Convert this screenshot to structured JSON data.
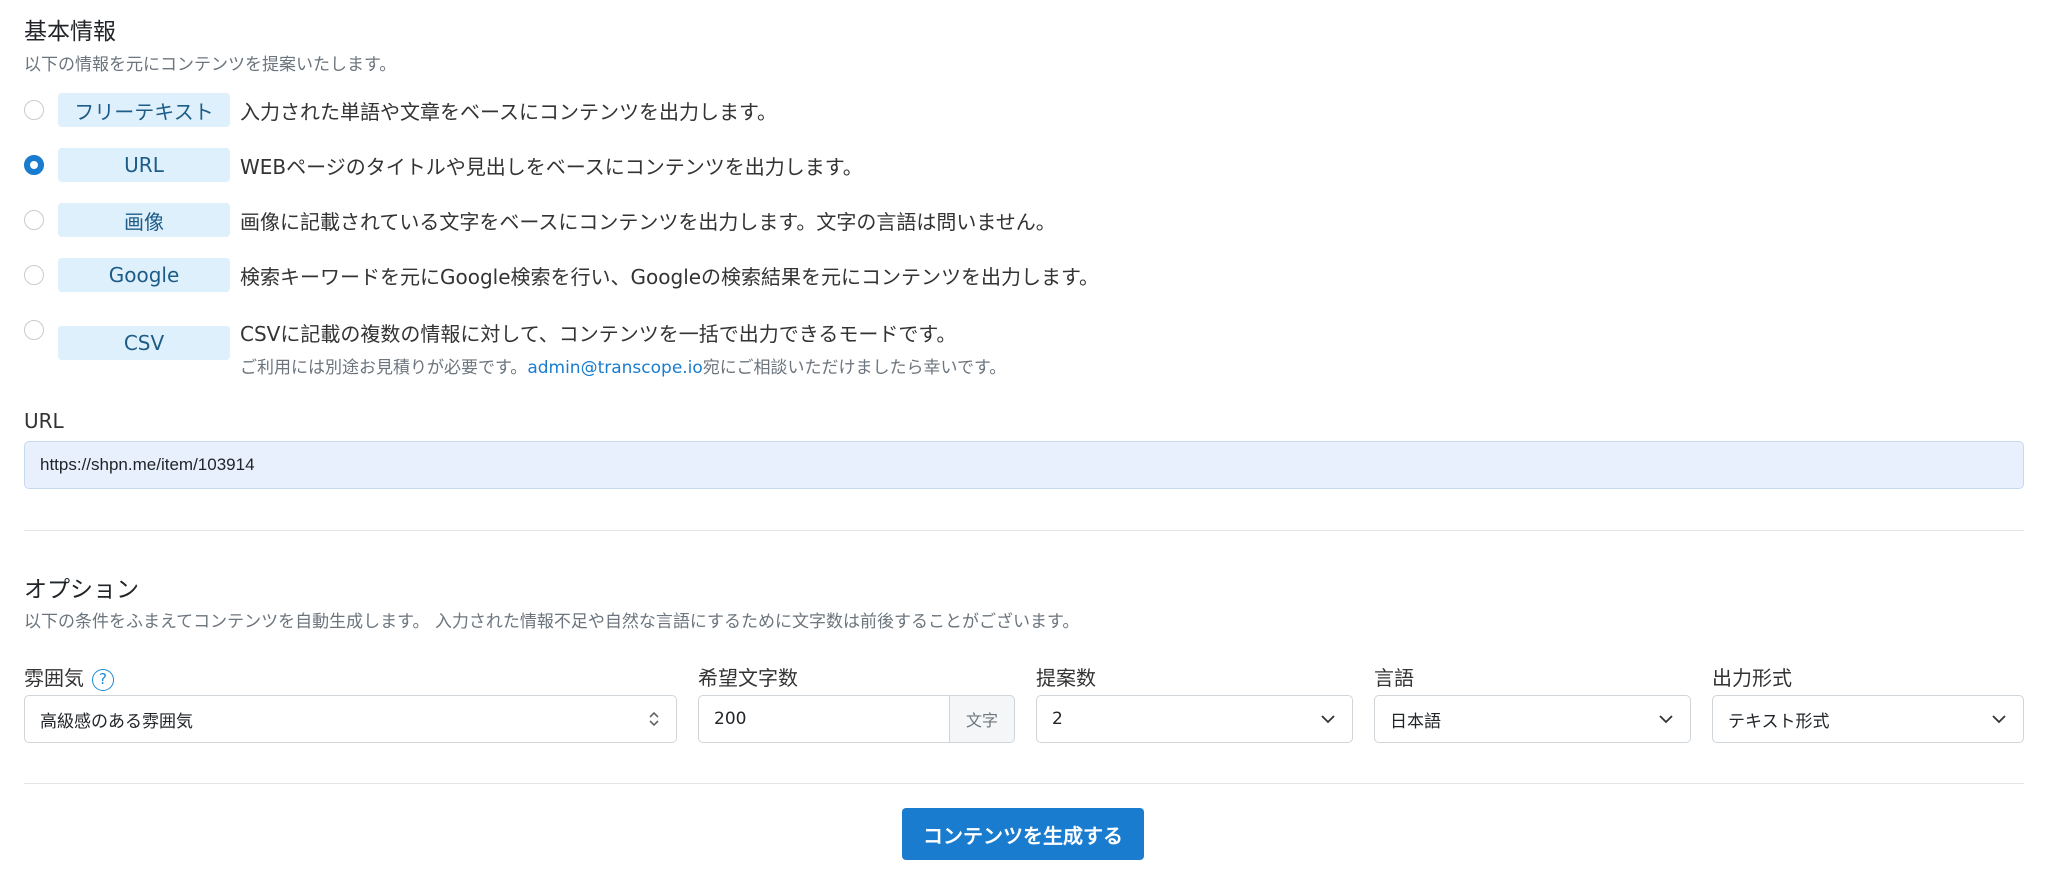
{
  "basic": {
    "title": "基本情報",
    "description": "以下の情報を元にコンテンツを提案いたします。",
    "options": [
      {
        "label": "フリーテキスト",
        "description": "入力された単語や文章をベースにコンテンツを出力します。",
        "checked": false
      },
      {
        "label": "URL",
        "description": "WEBページのタイトルや見出しをベースにコンテンツを出力します。",
        "checked": true
      },
      {
        "label": "画像",
        "description": "画像に記載されている文字をベースにコンテンツを出力します。文字の言語は問いません。",
        "checked": false
      },
      {
        "label": "Google",
        "description": "検索キーワードを元にGoogle検索を行い、Googleの検索結果を元にコンテンツを出力します。",
        "checked": false
      },
      {
        "label": "CSV",
        "description": "CSVに記載の複数の情報に対して、コンテンツを一括で出力できるモードです。",
        "checked": false,
        "note_prefix": "ご利用には別途お見積りが必要です。",
        "note_email": "admin@transcope.io",
        "note_suffix": "宛にご相談いただけましたら幸いです。"
      }
    ]
  },
  "url": {
    "label": "URL",
    "value": "https://shpn.me/item/103914"
  },
  "options_section": {
    "title": "オプション",
    "description": "以下の条件をふまえてコンテンツを自動生成します。 入力された情報不足や自然な言語にするために文字数は前後することがございます。"
  },
  "fields": {
    "mood": {
      "label": "雰囲気",
      "value": "高級感のある雰囲気",
      "help": "?"
    },
    "length": {
      "label": "希望文字数",
      "value": "200",
      "suffix": "文字"
    },
    "count": {
      "label": "提案数",
      "value": "2"
    },
    "language": {
      "label": "言語",
      "value": "日本語"
    },
    "format": {
      "label": "出力形式",
      "value": "テキスト形式"
    }
  },
  "submit": {
    "label": "コンテンツを生成する"
  },
  "colors": {
    "accent": "#1a7ccf",
    "pill_bg": "#def0fb",
    "pill_text": "#1d5c87",
    "url_bg": "#e8f0fe"
  }
}
